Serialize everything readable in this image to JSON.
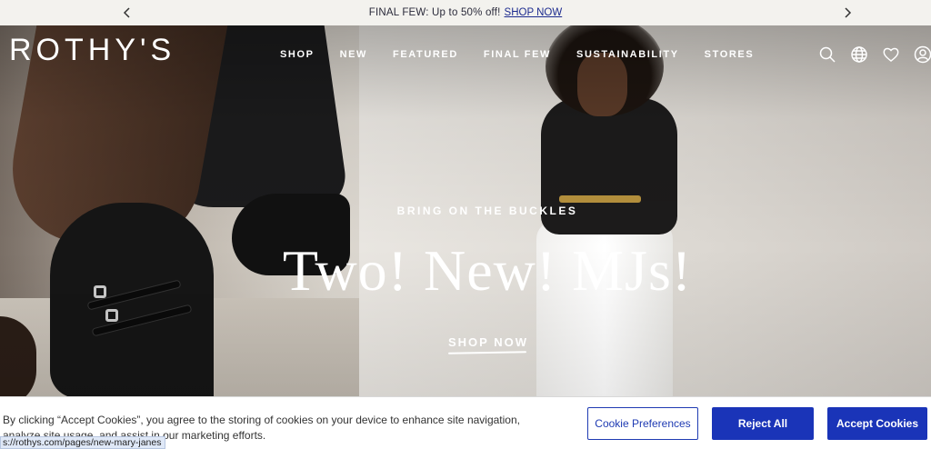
{
  "announcement": {
    "text": "FINAL FEW: Up to 50% off!",
    "link": "SHOP NOW"
  },
  "header": {
    "logo": "ROTHY'S",
    "nav": [
      "SHOP",
      "NEW",
      "FEATURED",
      "FINAL FEW",
      "SUSTAINABILITY",
      "STORES"
    ],
    "icons": [
      "search-icon",
      "globe-icon",
      "heart-icon",
      "account-icon"
    ]
  },
  "hero": {
    "eyebrow": "BRING ON THE BUCKLES",
    "headline": "Two! New! MJs!",
    "cta": "SHOP NOW"
  },
  "cookie": {
    "message": "By clicking “Accept Cookies”, you agree to the storing of cookies on your device to enhance site navigation, analyze site usage, and assist in our marketing efforts.",
    "preferences": "Cookie Preferences",
    "reject": "Reject All",
    "accept": "Accept Cookies"
  },
  "status_url": "s://rothys.com/pages/new-mary-janes",
  "colors": {
    "primary_button": "#1a34b8",
    "announcement_bg": "#f3f2ee"
  }
}
